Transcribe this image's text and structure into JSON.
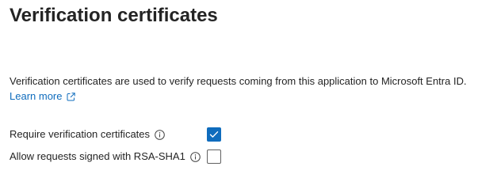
{
  "header": {
    "title": "Verification certificates"
  },
  "content": {
    "description": "Verification certificates are used to verify requests coming from this application to Microsoft Entra ID.",
    "learn_more": "Learn more",
    "learn_more_icon": "external-link-icon"
  },
  "options": [
    {
      "label": "Require verification certificates",
      "info_icon": "info-icon",
      "checked": true
    },
    {
      "label": "Allow requests signed with RSA-SHA1",
      "info_icon": "info-icon",
      "checked": false
    }
  ],
  "colors": {
    "accent": "#0f6cbd",
    "text": "#242424",
    "checkbox_border": "#616161"
  }
}
